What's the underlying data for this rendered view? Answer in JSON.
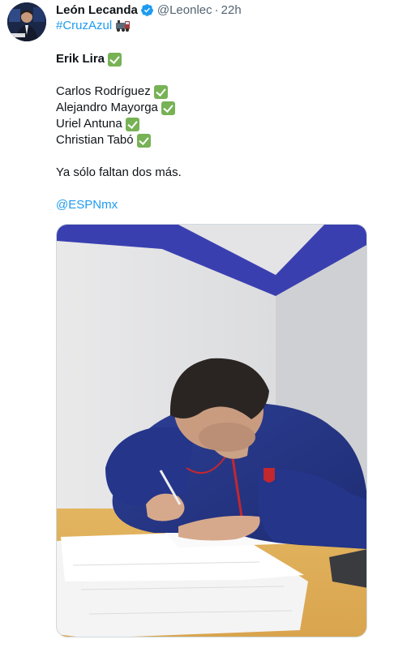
{
  "tweet": {
    "author_name": "León Lecanda",
    "handle": "@Leonlec",
    "separator": "·",
    "time": "22h",
    "hashtag": "#CruzAzul",
    "headline": "Erik Lira",
    "players": [
      "Carlos Rodríguez",
      "Alejandro Mayorga",
      "Uriel Antuna",
      "Christian Tabó"
    ],
    "closing_text": "Ya sólo faltan dos más.",
    "mention": "@ESPNmx"
  },
  "icons": {
    "verified": "verified-badge-icon",
    "train": "train-emoji-icon",
    "check": "check-mark-button-emoji"
  },
  "colors": {
    "link": "#1d9bf0",
    "secondary_text": "#536471",
    "verified": "#1d9bf0",
    "check": "#77b255"
  }
}
